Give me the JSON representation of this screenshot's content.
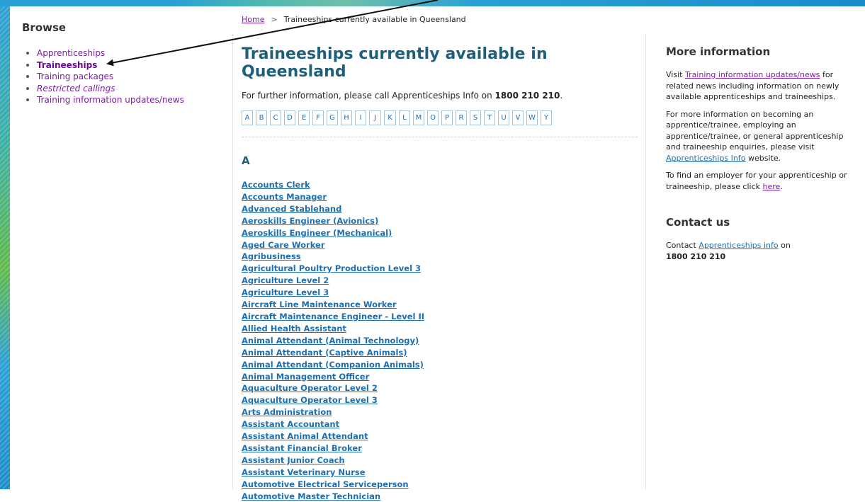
{
  "sidebar": {
    "title": "Browse",
    "items": [
      {
        "label": "Apprenticeships"
      },
      {
        "label": "Traineeships"
      },
      {
        "label": "Training packages"
      },
      {
        "label": "Restricted callings"
      },
      {
        "label": "Training information updates/news"
      }
    ]
  },
  "breadcrumb": {
    "home": "Home",
    "separator": ">",
    "current": "Traineeships currently available in Queensland"
  },
  "main": {
    "title": "Traineeships currently available in Queensland",
    "intro_prefix": "For further information, please call Apprenticeships Info on ",
    "intro_phone": "1800 210 210",
    "intro_suffix": ".",
    "letters": [
      "A",
      "B",
      "C",
      "D",
      "E",
      "F",
      "G",
      "H",
      "I",
      "J",
      "K",
      "L",
      "M",
      "O",
      "P",
      "R",
      "S",
      "T",
      "U",
      "V",
      "W",
      "Y"
    ],
    "section_letter": "A",
    "traineeships": [
      "Accounts Clerk",
      "Accounts Manager",
      "Advanced Stablehand",
      "Aeroskills Engineer (Avionics)",
      "Aeroskills Engineer (Mechanical)",
      "Aged Care Worker",
      "Agribusiness",
      "Agricultural Poultry Production Level 3",
      "Agriculture Level 2",
      "Agriculture Level 3",
      "Aircraft Line Maintenance Worker",
      "Aircraft Maintenance Engineer - Level II",
      "Allied Health Assistant",
      "Animal Attendant (Animal Technology)",
      "Animal Attendant (Captive Animals)",
      "Animal Attendant (Companion Animals)",
      "Animal Management Officer",
      "Aquaculture Operator Level 2",
      "Aquaculture Operator Level 3",
      "Arts Administration",
      "Assistant Accountant",
      "Assistant Animal Attendant",
      "Assistant Financial Broker",
      "Assistant Junior Coach",
      "Assistant Veterinary Nurse",
      "Automotive Electrical Serviceperson",
      "Automotive Master Technician"
    ]
  },
  "right": {
    "more_title": "More information",
    "p1_prefix": "Visit ",
    "p1_link": "Training information updates/news",
    "p1_suffix": " for related news including information on newly available apprenticeships and traineeships.",
    "p2_prefix": "For more information on becoming an apprentice/trainee, employing an apprentice/trainee, or general apprenticeship and traineeship enquiries, please visit ",
    "p2_link": "Apprenticeships Info",
    "p2_suffix": " website.",
    "p3_prefix": "To find an employer for your apprenticeship or traineeship, please click ",
    "p3_link": "here",
    "p3_suffix": ".",
    "contact_title": "Contact us",
    "contact_prefix": "Contact ",
    "contact_link": "Apprenticeships info",
    "contact_suffix": " on",
    "contact_phone": "1800 210 210"
  }
}
